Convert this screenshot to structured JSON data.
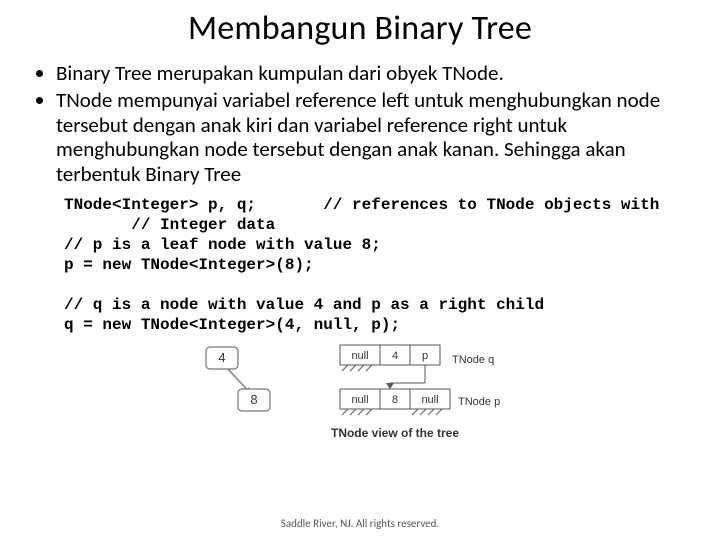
{
  "title": "Membangun Binary Tree",
  "bullets": [
    "Binary Tree merupakan kumpulan dari obyek TNode.",
    "TNode mempunyai variabel reference left untuk menghubungkan node tersebut dengan anak kiri dan variabel reference right untuk menghubungkan node tersebut dengan anak kanan. Sehingga akan terbentuk Binary Tree"
  ],
  "code": "TNode<Integer> p, q;       // references to TNode objects with\n       // Integer data\n// p is a leaf node with value 8;\np = new TNode<Integer>(8);\n\n// q is a node with value 4 and p as a right child\nq = new TNode<Integer>(4, null, p);",
  "diagram": {
    "node4": "4",
    "node8": "8",
    "q_left": "null",
    "q_mid": "4",
    "q_right": "p",
    "q_label": "TNode q",
    "p_left": "null",
    "p_mid": "8",
    "p_right": "null",
    "p_label": "TNode p",
    "caption": "TNode view of the tree"
  },
  "footer": "Saddle River, NJ.  All rights reserved."
}
